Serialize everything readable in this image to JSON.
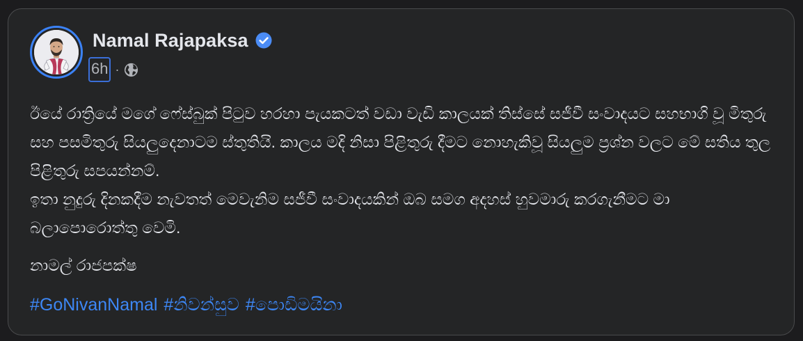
{
  "post": {
    "author": {
      "name": "Namal Rajapaksa",
      "verified": true
    },
    "timestamp": "6h",
    "separator": "·",
    "audience_icon": "globe-icon",
    "body": {
      "paragraph_1": "ඊයේ රාත්‍රියේ මගේ ෆේස්බුක් පිටුව හරහා පැයකටත් වඩා වැඩි කාලයක් තිස්සේ සජීවී සංවාදයට සහභාගි වූ මිතුරු සහ පසමිතුරු සියලුදෙනාටම ස්තුතියි. කාලය මදි නිසා පිළිතුරු දීමට නොහැකිවූ සියලුම ප්‍රශ්න වලට මේ සතිය තුල පිළිතුරු සපයන්නම්.",
      "paragraph_2": "ඉතා නුදුරු දිනකදීම නැවතත් මෙවැනිම සජීවී සංවාදයකින් ඔබ සමග අදහස් හුවමාරු කරගැනීමට මා බලාපොරොත්තු වෙමි.",
      "signature": "නාමල් රාජපක්ෂ"
    },
    "hashtags": [
      "#GoNivanNamal",
      "#නිවන්සුව",
      "#පොඩිමයිනා"
    ]
  },
  "colors": {
    "card_background": "#242526",
    "page_background": "#1c1c1e",
    "text_primary": "#e4e6eb",
    "text_secondary": "#b0b3b8",
    "hashtag": "#3d87f5",
    "verified_badge": "#4b8cf5",
    "focus_ring": "#3b6fd8"
  }
}
